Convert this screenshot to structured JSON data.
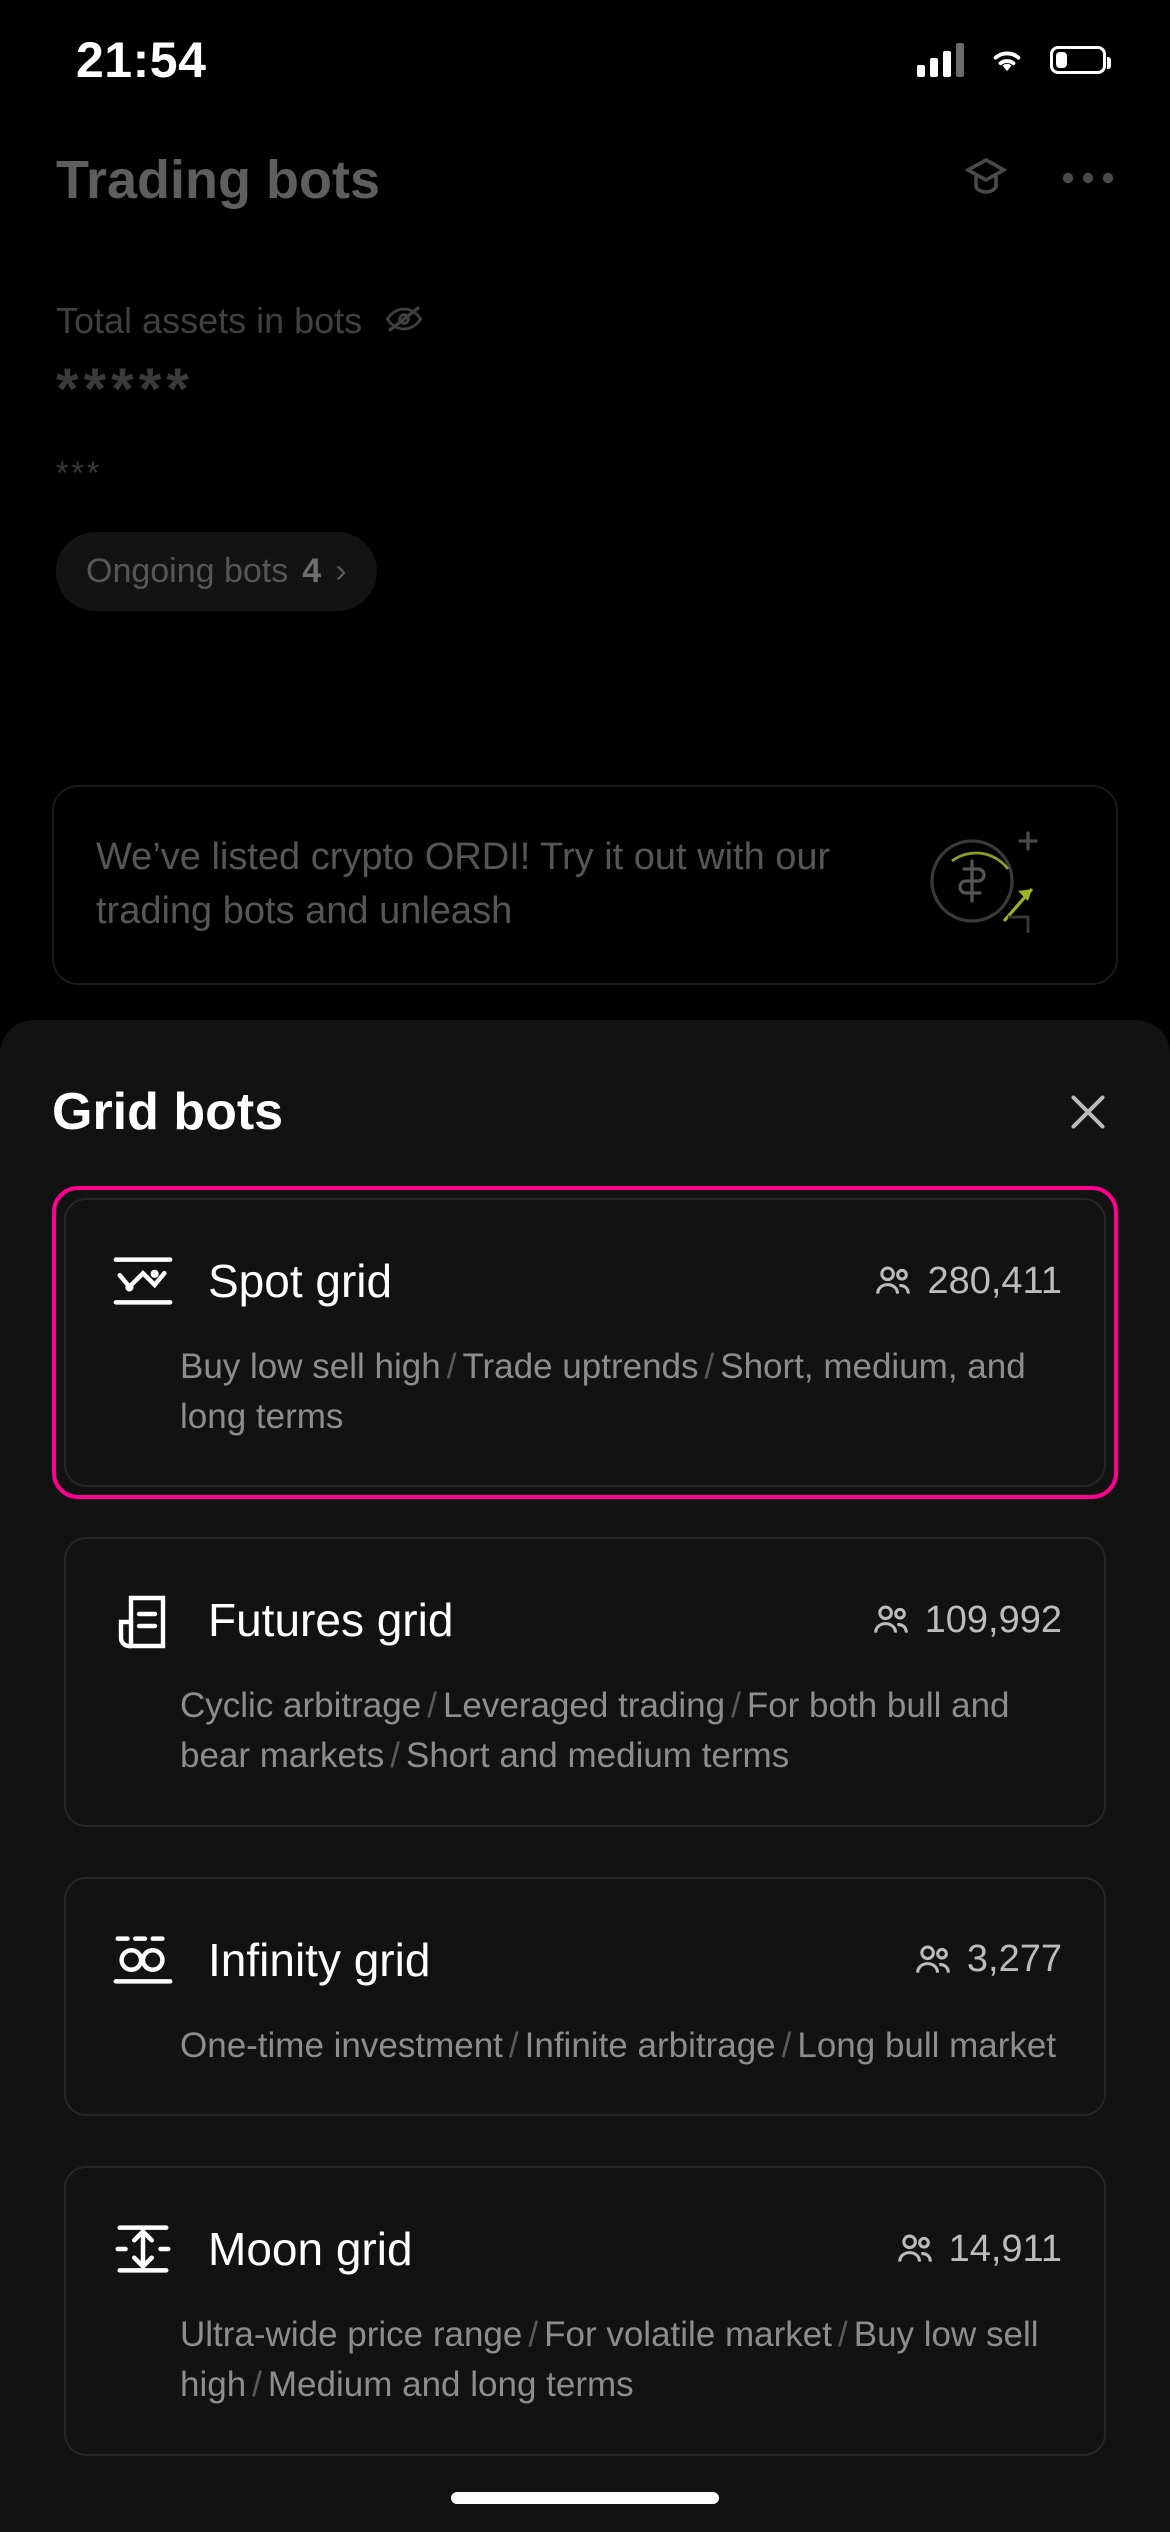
{
  "status_bar": {
    "time": "21:54",
    "signal_icon": "cellular-signal-icon",
    "wifi_icon": "wifi-icon",
    "battery_icon": "battery-icon"
  },
  "background_page": {
    "title": "Trading bots",
    "actions": [
      {
        "name": "graduation-cap-icon",
        "label": "Tutorial"
      },
      {
        "name": "more-options-icon",
        "label": "···"
      }
    ],
    "assets_label": "Total assets in bots",
    "assets_visibility_icon": "eye-off-icon",
    "assets_value_masked": "*****",
    "assets_sub_masked": "***",
    "ongoing_bots_label": "Ongoing bots",
    "ongoing_bots_count": "4",
    "ongoing_bots_chevron": "›",
    "promo_text": "We’ve listed crypto ORDI! Try it out with our trading bots and unleash",
    "promo_icon": "dollar-coin-growth-icon"
  },
  "sheet": {
    "title": "Grid bots",
    "close_icon": "close-icon",
    "selected_card_border_color": "#FF0090",
    "users_icon": "people-icon",
    "cards": [
      {
        "id": "spot-grid",
        "icon": "spot-grid-icon",
        "name": "Spot grid",
        "users": "280,411",
        "desc_parts": [
          "Buy low sell high",
          "Trade uptrends",
          "Short, medium, and long terms"
        ],
        "selected": true
      },
      {
        "id": "futures-grid",
        "icon": "futures-grid-icon",
        "name": "Futures grid",
        "users": "109,992",
        "desc_parts": [
          "Cyclic arbitrage",
          "Leveraged trading",
          "For both bull and bear markets",
          "Short and medium terms"
        ],
        "selected": false
      },
      {
        "id": "infinity-grid",
        "icon": "infinity-grid-icon",
        "name": "Infinity grid",
        "users": "3,277",
        "desc_parts": [
          "One-time investment",
          "Infinite arbitrage",
          "Long bull market"
        ],
        "selected": false
      },
      {
        "id": "moon-grid",
        "icon": "moon-grid-icon",
        "name": "Moon grid",
        "users": "14,911",
        "desc_parts": [
          "Ultra-wide price range",
          "For volatile market",
          "Buy low sell high",
          "Medium and long terms"
        ],
        "selected": false
      }
    ]
  },
  "home_indicator": "home-indicator"
}
